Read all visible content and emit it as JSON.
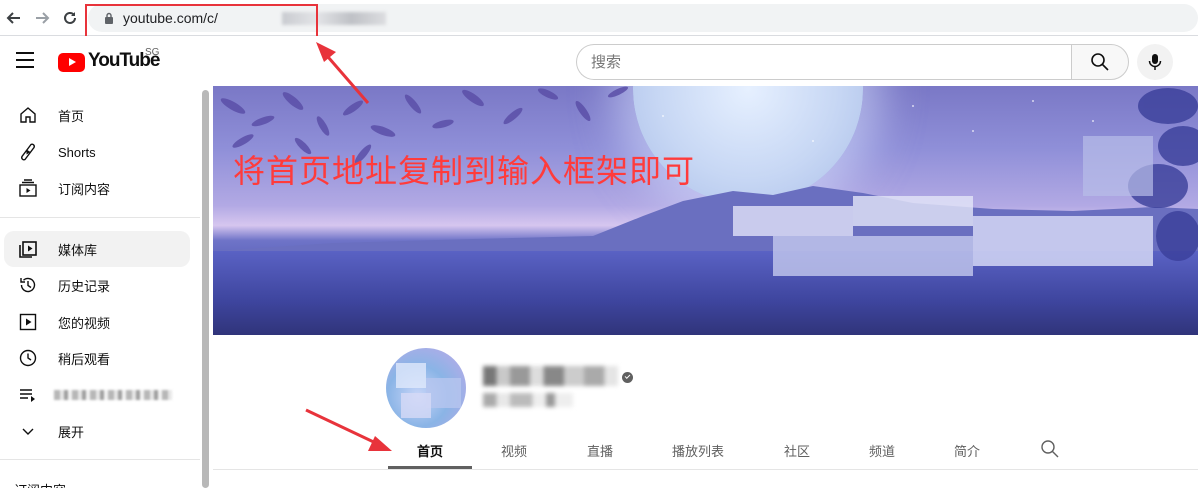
{
  "browser": {
    "url_visible": "youtube.com/c/",
    "back_icon": "back-arrow-icon",
    "forward_icon": "forward-arrow-icon",
    "reload_icon": "reload-icon"
  },
  "header": {
    "logo_text": "YouTube",
    "region": "SG",
    "search_placeholder": "搜索"
  },
  "sidebar": {
    "items": [
      {
        "label": "首页",
        "icon": "home-icon"
      },
      {
        "label": "Shorts",
        "icon": "shorts-icon"
      },
      {
        "label": "订阅内容",
        "icon": "subscriptions-icon"
      },
      {
        "label": "媒体库",
        "icon": "library-icon",
        "active": true
      },
      {
        "label": "历史记录",
        "icon": "history-icon"
      },
      {
        "label": "您的视频",
        "icon": "your-videos-icon"
      },
      {
        "label": "稍后观看",
        "icon": "watch-later-icon"
      },
      {
        "label": "",
        "icon": "playlist-icon"
      },
      {
        "label": "展开",
        "icon": "chevron-down-icon"
      }
    ],
    "section_title": "订阅内容"
  },
  "banner": {
    "annotation": "将首页地址复制到输入框架即可"
  },
  "tabs": [
    {
      "label": "首页",
      "active": true
    },
    {
      "label": "视频"
    },
    {
      "label": "直播"
    },
    {
      "label": "播放列表"
    },
    {
      "label": "社区"
    },
    {
      "label": "频道"
    },
    {
      "label": "简介"
    }
  ],
  "colors": {
    "annotation_red": "#e8333b",
    "brand_red": "#ff0000",
    "active_bg": "#f2f2f2"
  }
}
